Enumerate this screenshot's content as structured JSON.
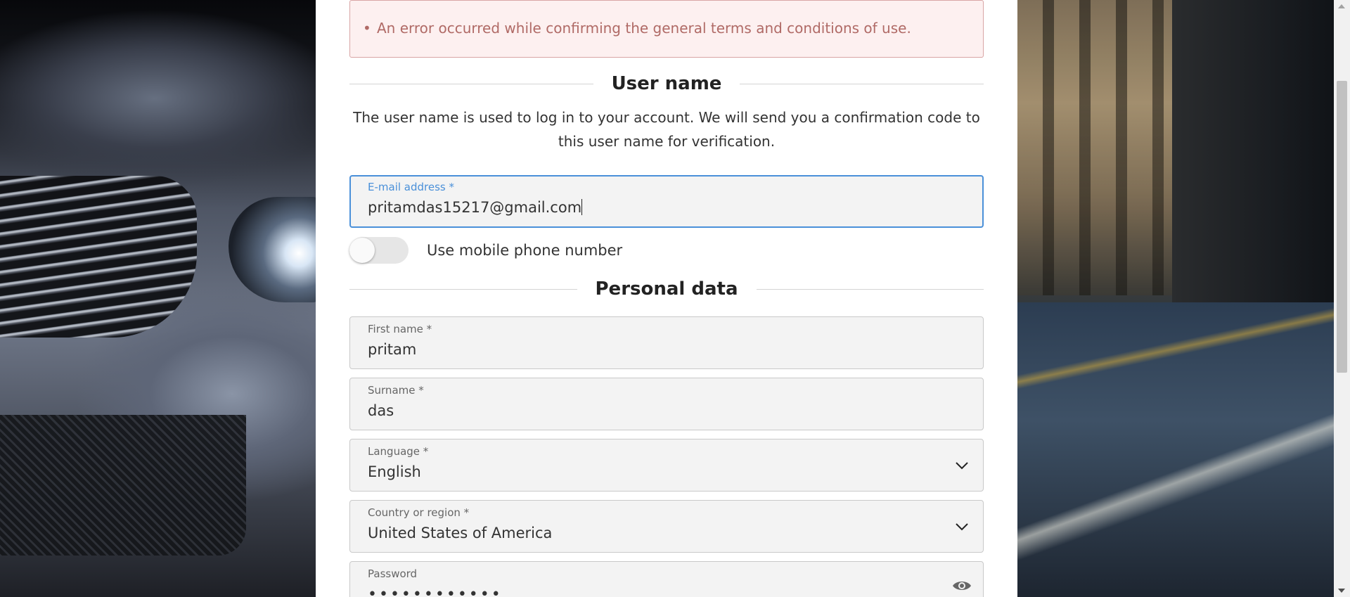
{
  "error": {
    "items": [
      "An error occurred while confirming the general terms and conditions of use."
    ]
  },
  "username_section": {
    "title": "User name",
    "description": "The user name is used to log in to your account. We will send you a confirmation code to this user name for verification."
  },
  "email_field": {
    "label": "E-mail address *",
    "value": "pritamdas15217@gmail.com"
  },
  "phone_toggle": {
    "label": "Use mobile phone number",
    "on": false
  },
  "personal_section": {
    "title": "Personal data"
  },
  "first_name_field": {
    "label": "First name *",
    "value": "pritam"
  },
  "surname_field": {
    "label": "Surname *",
    "value": "das"
  },
  "language_field": {
    "label": "Language *",
    "value": "English"
  },
  "country_field": {
    "label": "Country or region *",
    "value": "United States of America"
  },
  "password_field": {
    "label": "Password",
    "value": "••••••••••••"
  },
  "colors": {
    "accent": "#4a90d9",
    "error_text": "#b06a66",
    "error_bg": "#fdf0f0"
  },
  "icons": [
    "chevron-down-icon",
    "eye-icon"
  ]
}
